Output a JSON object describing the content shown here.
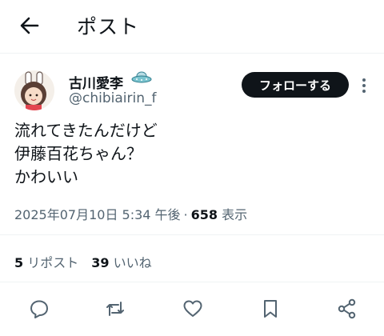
{
  "header": {
    "title": "ポスト"
  },
  "author": {
    "display_name": "古川愛李",
    "handle": "@chibiairin_f"
  },
  "follow_label": "フォローする",
  "tweet": {
    "lines": [
      "流れてきたんだけど",
      "伊藤百花ちゃん？",
      "かわいい"
    ],
    "timestamp": "2025年07月10日 5:34 午後",
    "separator": "·",
    "views_count": "658",
    "views_label": "表示"
  },
  "stats": {
    "reposts_count": "5",
    "reposts_label": "リポスト",
    "likes_count": "39",
    "likes_label": "いいね"
  },
  "icons": [
    "back-arrow-icon",
    "verified-ufo-icon",
    "more-icon",
    "reply-icon",
    "repost-icon",
    "like-icon",
    "bookmark-icon",
    "share-icon"
  ],
  "colors": {
    "text": "#0f1419",
    "secondary": "#536471",
    "button": "#0f1419",
    "divider": "#eff3f4"
  }
}
